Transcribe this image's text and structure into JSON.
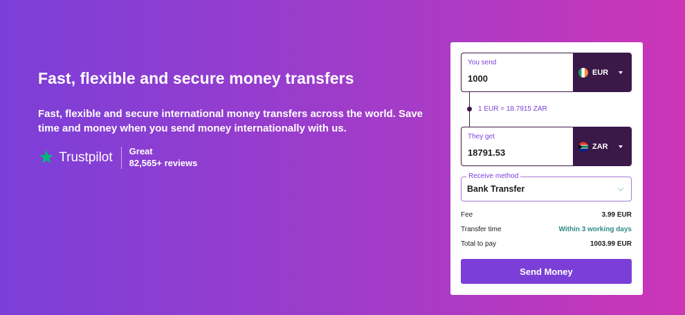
{
  "hero": {
    "title": "Fast, flexible and secure money transfers",
    "subtitle": "Fast, flexible and secure international money transfers across the world. Save time and money when you send money internationally with us."
  },
  "trustpilot": {
    "brand": "Trustpilot",
    "rating": "Great",
    "reviews": "82,565+ reviews",
    "star_color": "#00b67a"
  },
  "converter": {
    "send": {
      "label": "You send",
      "value": "1000",
      "currency": "EUR",
      "flag_icon": "ireland-flag-icon"
    },
    "rate": "1 EUR = 18.7915 ZAR",
    "get": {
      "label": "They get",
      "value": "18791.53",
      "currency": "ZAR",
      "flag_icon": "south-africa-flag-icon"
    },
    "receive_method": {
      "label": "Receive method",
      "value": "Bank Transfer"
    },
    "summary": {
      "fee_label": "Fee",
      "fee_value": "3.99 EUR",
      "time_label": "Transfer time",
      "time_value": "Within 3 working days",
      "total_label": "Total to pay",
      "total_value": "1003.99 EUR"
    },
    "button": "Send Money"
  },
  "colors": {
    "gradient_start": "#7b3fd8",
    "gradient_end": "#cc35b6",
    "dark_purple": "#3a1848",
    "accent": "#7b3fd8",
    "teal": "#2f8a86"
  }
}
